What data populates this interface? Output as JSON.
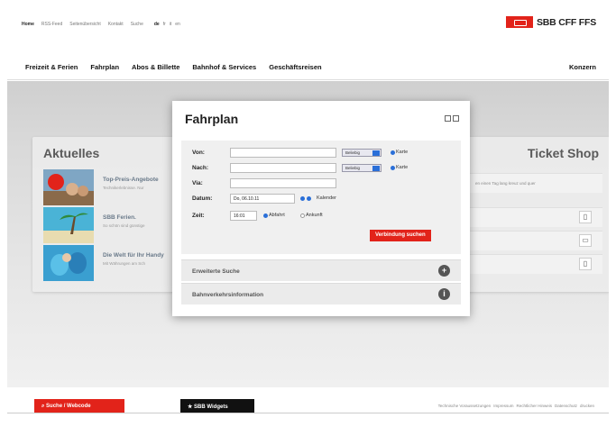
{
  "util_nav": {
    "items": [
      "Home",
      "RSS-Feed",
      "Seitenübersicht",
      "Kontakt",
      "Suche"
    ],
    "langs": [
      "de",
      "fr",
      "it",
      "en"
    ]
  },
  "brand": {
    "name": "SBB CFF FFS",
    "color": "#e2231a"
  },
  "main_nav": {
    "items": [
      "Freizeit & Ferien",
      "Fahrplan",
      "Abos & Billette",
      "Bahnhof & Services",
      "Geschäftsreisen"
    ],
    "right": "Konzern"
  },
  "aktuelles": {
    "title": "Aktuelles",
    "items": [
      {
        "title": "Top-Preis-Angebote",
        "desc": "Technikerlebnisse. Nur"
      },
      {
        "title": "SBB Ferien.",
        "desc": "So schön sind günstige"
      },
      {
        "title": "Die Welt für Ihr Handy",
        "desc": "Mit Währungen am Sch"
      }
    ]
  },
  "ticketshop": {
    "title": "Ticket Shop",
    "rows": [
      {
        "desc": "en einen Tag lang kreuz und quer",
        "icon": "ticket-icon"
      },
      {
        "desc": "",
        "icon": "ticket-icon"
      },
      {
        "desc": "",
        "icon": "card-icon"
      },
      {
        "desc": "",
        "icon": "ticket-icon"
      }
    ]
  },
  "fahrplan": {
    "title": "Fahrplan",
    "labels": {
      "von": "Von:",
      "nach": "Nach:",
      "via": "Via:",
      "datum": "Datum:",
      "zeit": "Zeit:"
    },
    "values": {
      "von": "",
      "nach": "",
      "via": "",
      "datum": "Do, 06.10.11",
      "zeit": "16:01"
    },
    "select_label": "Beliebig",
    "karte_label": "Karte",
    "kalender_label": "Kalender",
    "abfahrt_label": "Abfahrt",
    "ankunft_label": "Ankunft",
    "abfahrt_selected": true,
    "submit_label": "Verbindung suchen",
    "accordion": [
      {
        "label": "Erweiterte Suche",
        "icon": "plus-icon"
      },
      {
        "label": "Bahnverkehrsinformation",
        "icon": "info-icon"
      }
    ]
  },
  "footer": {
    "search_label": "Suche / Webcode",
    "widgets_label": "SBB Widgets",
    "links": [
      "Technische Voraussetzungen",
      "Impressum",
      "Rechtlicher Hinweis",
      "Datenschutz",
      "drucken"
    ]
  }
}
